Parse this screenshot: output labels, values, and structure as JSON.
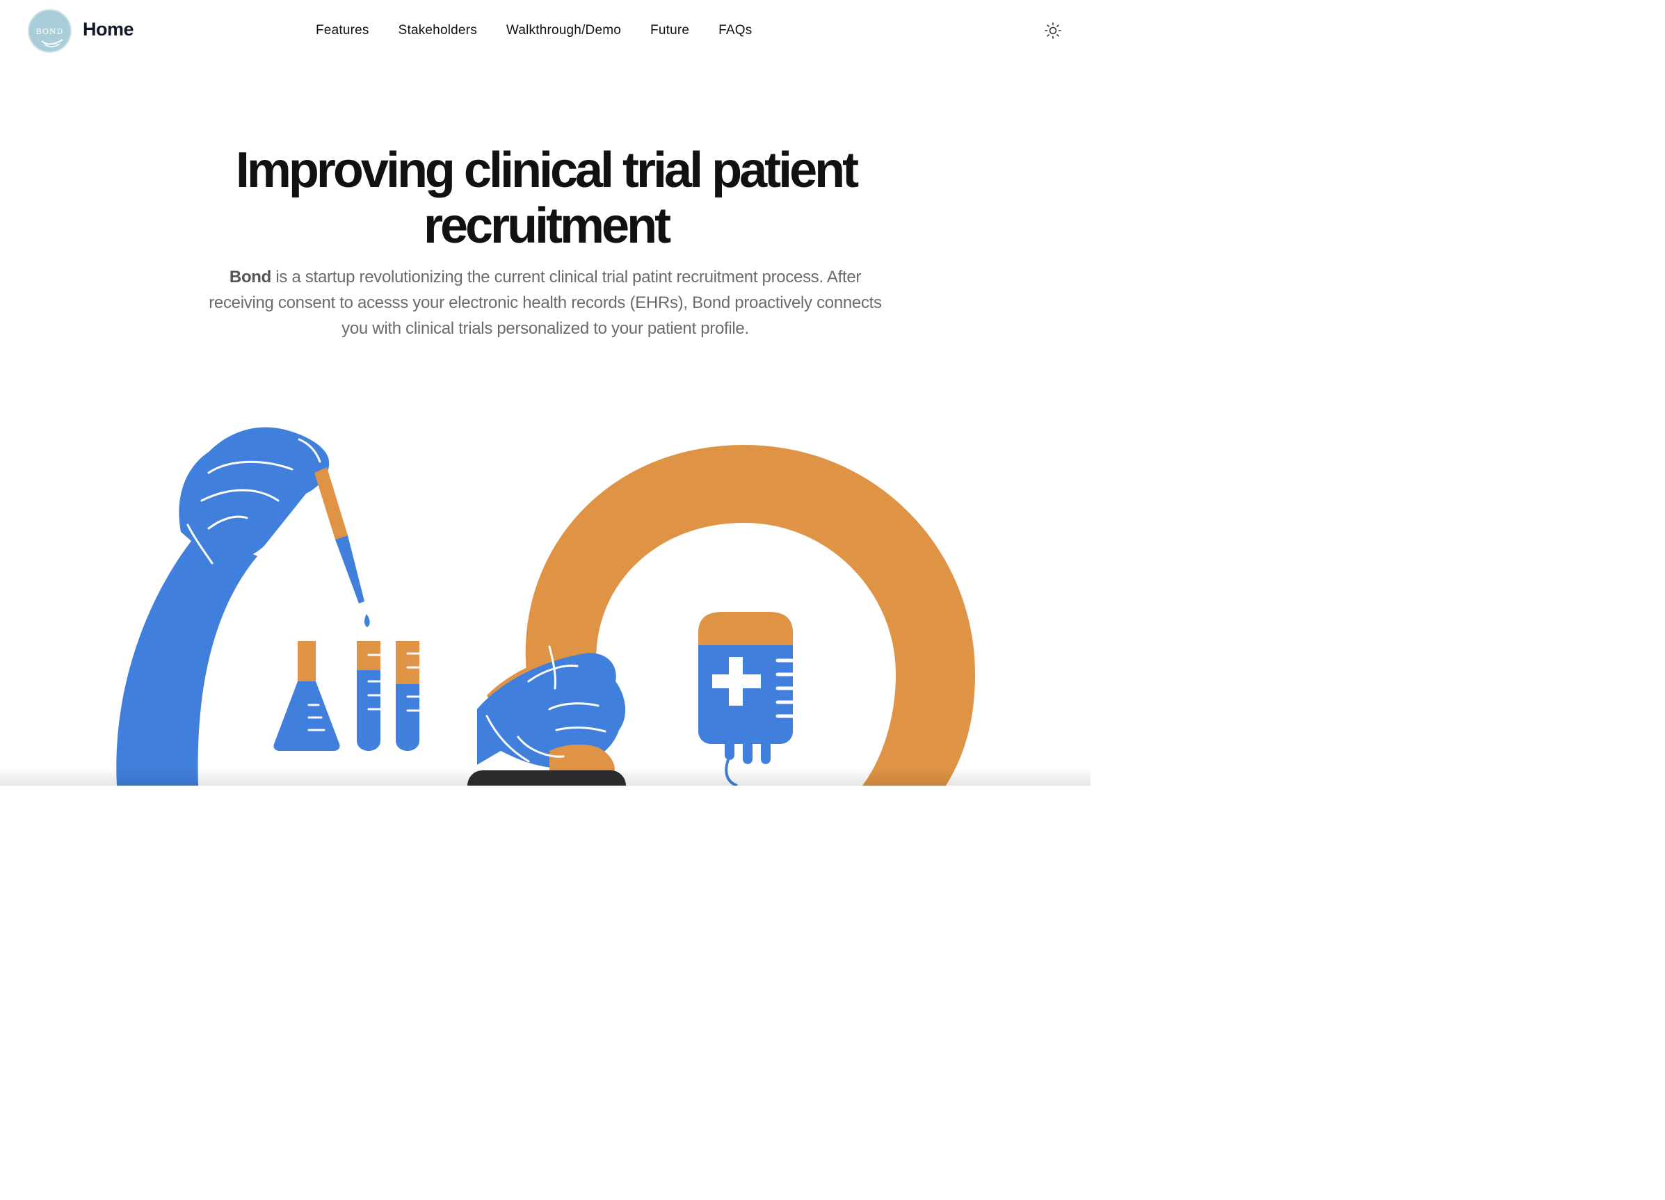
{
  "header": {
    "logo_text": "BOND",
    "brand": "Home",
    "nav": [
      {
        "label": "Features"
      },
      {
        "label": "Stakeholders"
      },
      {
        "label": "Walkthrough/Demo"
      },
      {
        "label": "Future"
      },
      {
        "label": "FAQs"
      }
    ],
    "theme_icon": "sun-icon"
  },
  "hero": {
    "title_line1": "Improving clinical trial patient",
    "title_line2": "recruitment",
    "subtitle_bold": "Bond",
    "subtitle_rest": " is a startup revolutionizing the current clinical trial patint recruitment process. After receiving consent to acesss your electronic health records (EHRs), Bond proactively connects you with clinical trials personalized to your patient profile."
  },
  "colors": {
    "blue": "#4080dc",
    "orange": "#de9444",
    "logo": "#a9cdd9"
  }
}
